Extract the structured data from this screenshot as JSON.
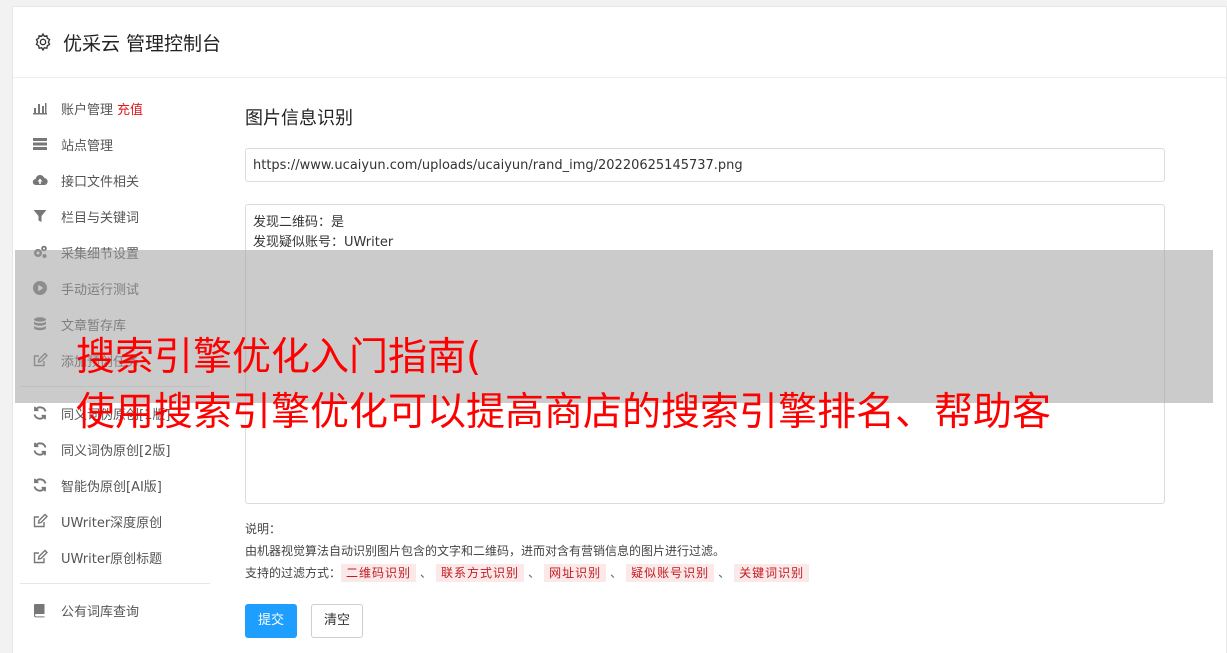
{
  "header": {
    "title": "优采云 管理控制台",
    "icon": "gear-icon"
  },
  "sidebar": {
    "group1": [
      {
        "label": "账户管理",
        "badge": "充值",
        "icon": "bar-chart-icon"
      },
      {
        "label": "站点管理",
        "icon": "server-icon"
      },
      {
        "label": "接口文件相关",
        "icon": "cloud-upload-icon"
      },
      {
        "label": "栏目与关键词",
        "icon": "filter-icon"
      },
      {
        "label": "采集细节设置",
        "icon": "gears-icon"
      },
      {
        "label": "手动运行测试",
        "icon": "play-circle-icon"
      },
      {
        "label": "文章暂存库",
        "icon": "database-icon"
      },
      {
        "label": "添加预创任务",
        "icon": "edit-icon"
      }
    ],
    "group2": [
      {
        "label": "同义词伪原创[1版]",
        "icon": "refresh-icon"
      },
      {
        "label": "同义词伪原创[2版]",
        "icon": "refresh-icon"
      },
      {
        "label": "智能伪原创[AI版]",
        "icon": "refresh-icon"
      },
      {
        "label": "UWriter深度原创",
        "icon": "edit-icon"
      },
      {
        "label": "UWriter原创标题",
        "icon": "edit-icon"
      }
    ],
    "group3": [
      {
        "label": "公有词库查询",
        "icon": "book-icon"
      }
    ]
  },
  "main": {
    "title": "图片信息识别",
    "url_value": "https://www.ucaiyun.com/uploads/ucaiyun/rand_img/20220625145737.png",
    "result_text": "发现二维码：是\n发现疑似账号：UWriter",
    "desc_label": "说明：",
    "desc_text": "由机器视觉算法自动识别图片包含的文字和二维码，进而对含有营销信息的图片进行过滤。",
    "filter_label": "支持的过滤方式：",
    "filter_tags": [
      "二维码识别",
      "联系方式识别",
      "网址识别",
      "疑似账号识别",
      "关键词识别"
    ],
    "tag_separator": "、",
    "submit_label": "提交",
    "clear_label": "清空"
  },
  "overlay": {
    "line1": "搜索引擎优化入门指南(",
    "line2": "使用搜索引擎优化可以提高商店的搜索引擎排名、帮助客"
  },
  "colors": {
    "accent": "#1e9fff",
    "danger": "#e0191e",
    "overlay_text": "#ff0000"
  }
}
